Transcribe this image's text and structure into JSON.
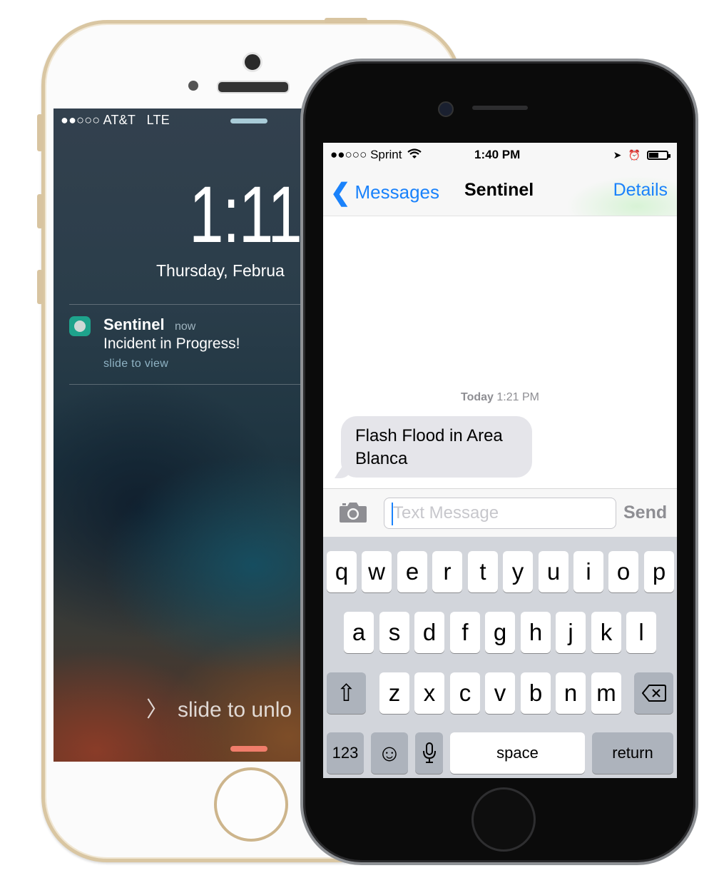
{
  "lock_screen": {
    "carrier": "●●○○○ AT&T",
    "network": "LTE",
    "time": "1:11",
    "date": "Thursday, Februa",
    "notification": {
      "app_name": "Sentinel",
      "time": "now",
      "message": "Incident in Progress!",
      "action": "slide to view"
    },
    "unlock_chevron": "〉",
    "unlock_label": "slide to unlo"
  },
  "messages": {
    "status_bar": {
      "carrier": "●●○○○ Sprint",
      "time": "1:40 PM",
      "location_icon": "➤",
      "alarm_icon": "⏰"
    },
    "nav": {
      "back_label": "Messages",
      "back_chevron": "❮",
      "title": "Sentinel",
      "details_label": "Details"
    },
    "timestamp_day": "Today",
    "timestamp_time": "1:21 PM",
    "bubble_text": "Flash Flood in Area Blanca",
    "input_placeholder": "Text Message",
    "send_label": "Send"
  },
  "keyboard": {
    "row1": [
      "q",
      "w",
      "e",
      "r",
      "t",
      "y",
      "u",
      "i",
      "o",
      "p"
    ],
    "row2": [
      "a",
      "s",
      "d",
      "f",
      "g",
      "h",
      "j",
      "k",
      "l"
    ],
    "row3": [
      "z",
      "x",
      "c",
      "v",
      "b",
      "n",
      "m"
    ],
    "shift_symbol": "⇧",
    "numbers_label": "123",
    "emoji_symbol": "☺",
    "dictation_symbol": "🎤",
    "space_label": "space",
    "return_label": "return"
  }
}
